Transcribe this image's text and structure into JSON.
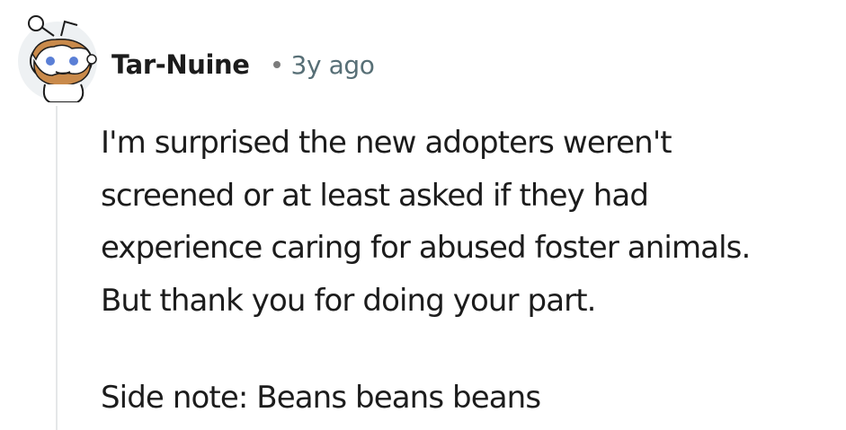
{
  "comment": {
    "author": "Tar-Nuine",
    "age": "3y ago",
    "paragraph1_lines": [
      "I'm surprised the new adopters weren't",
      "screened or at least asked if they had",
      "experience caring for abused foster animals.",
      "But thank you for doing your part."
    ],
    "paragraph2": "Side note: Beans beans beans"
  },
  "colors": {
    "text": "#1c1c1c",
    "meta": "#576f76",
    "thread_line": "#e5e7e8",
    "avatar_bg": "#eef1f3",
    "beard": "#c98a4b",
    "eyes": "#5a7fd6"
  },
  "icons": {
    "avatar": "reddit-snoo-avatar-icon"
  }
}
